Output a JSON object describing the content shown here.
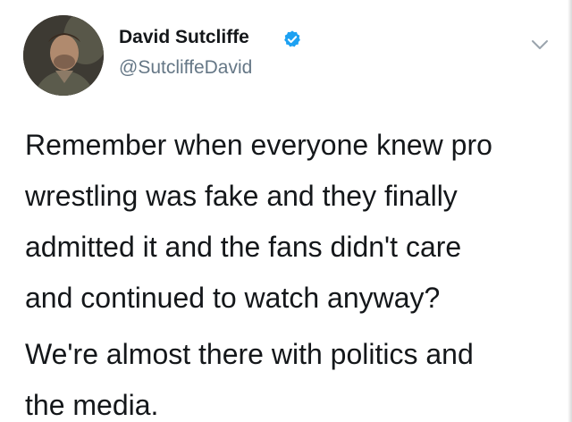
{
  "tweet": {
    "author": {
      "display_name": "David Sutcliffe",
      "handle": "@SutcliffeDavid",
      "verified": true,
      "verified_color": "#1da1f2"
    },
    "menu_icon": "chevron-down-icon",
    "paragraphs": [
      "Remember when everyone knew pro wrestling was fake and they finally admitted it and the fans didn't care and continued to watch anyway?",
      "We're almost there with politics and the media."
    ],
    "lines": {
      "p1": [
        "Remember when everyone knew pro",
        "wrestling was fake and they finally",
        "admitted it and the fans didn't care",
        "and continued to watch anyway?"
      ],
      "p2": [
        "We're almost there with politics and",
        "the media."
      ]
    }
  }
}
